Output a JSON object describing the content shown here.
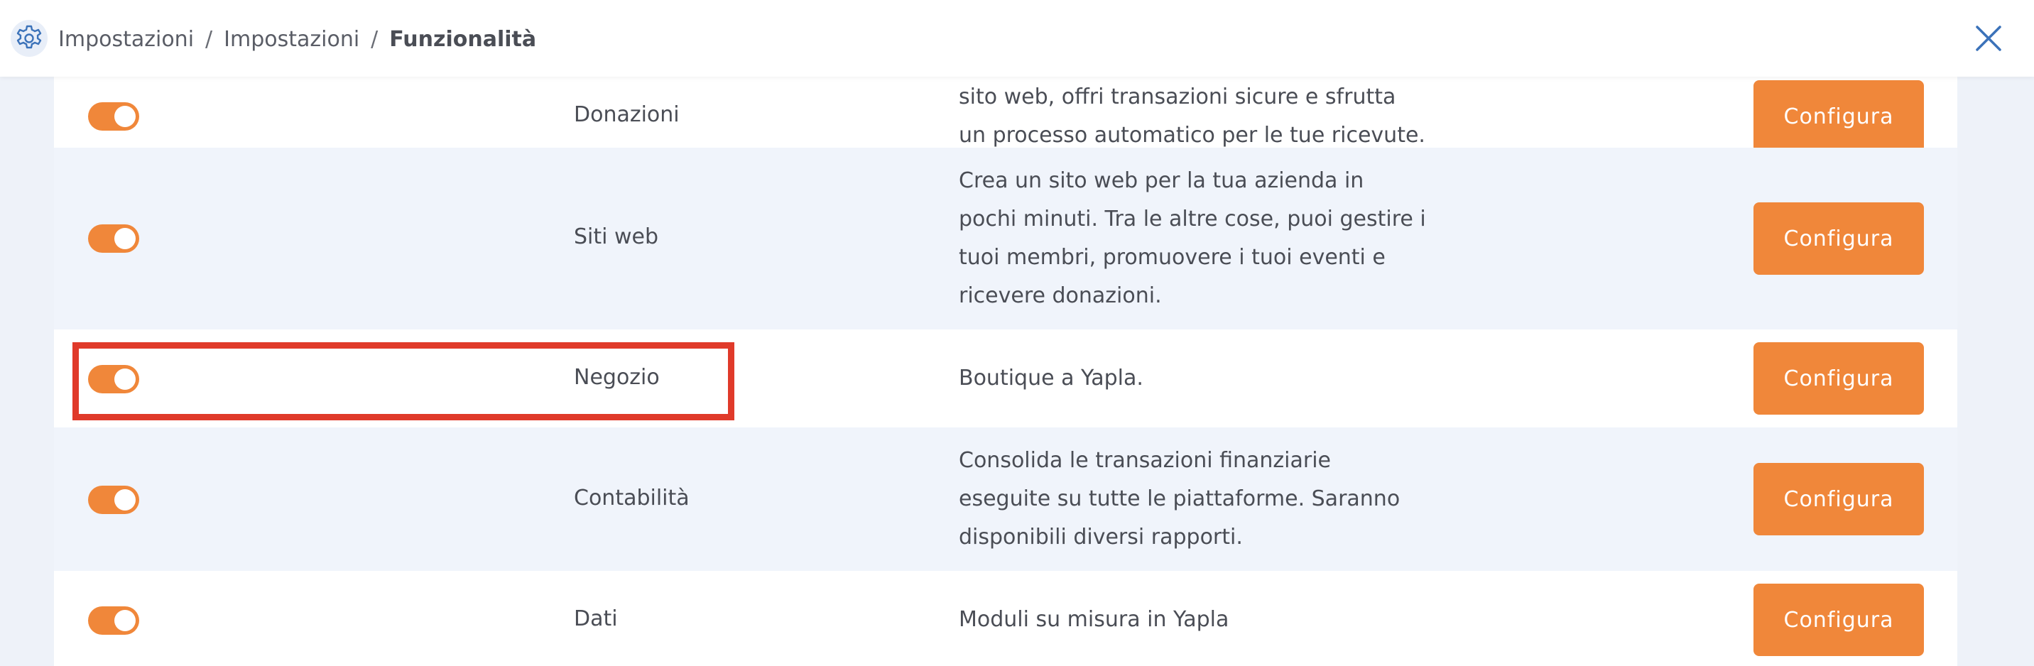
{
  "header": {
    "breadcrumb": [
      "Impostazioni",
      "Impostazioni",
      "Funzionalità"
    ],
    "separator": "/",
    "icons": {
      "settings": "gear-icon",
      "close": "close-icon"
    }
  },
  "features": [
    {
      "name": "Donazioni",
      "description": "sito web, offri transazioni sicure e sfrutta un processo automatico per le tue ricevute.",
      "enabled": true,
      "button": "Configura"
    },
    {
      "name": "Siti web",
      "description": "Crea un sito web per la tua azienda in pochi minuti. Tra le altre cose, puoi gestire i tuoi membri, promuovere i tuoi eventi e ricevere donazioni.",
      "enabled": true,
      "button": "Configura"
    },
    {
      "name": "Negozio",
      "description": "Boutique a Yapla.",
      "enabled": true,
      "button": "Configura"
    },
    {
      "name": "Contabilità",
      "description": "Consolida le transazioni finanziarie eseguite su tutte le piattaforme. Saranno disponibili diversi rapporti.",
      "enabled": true,
      "button": "Configura"
    },
    {
      "name": "Dati",
      "description": "Moduli su misura in Yapla",
      "enabled": true,
      "button": "Configura"
    }
  ],
  "colors": {
    "accent": "#f0873a",
    "highlight": "#e03a2a",
    "background": "#eef2f9"
  }
}
